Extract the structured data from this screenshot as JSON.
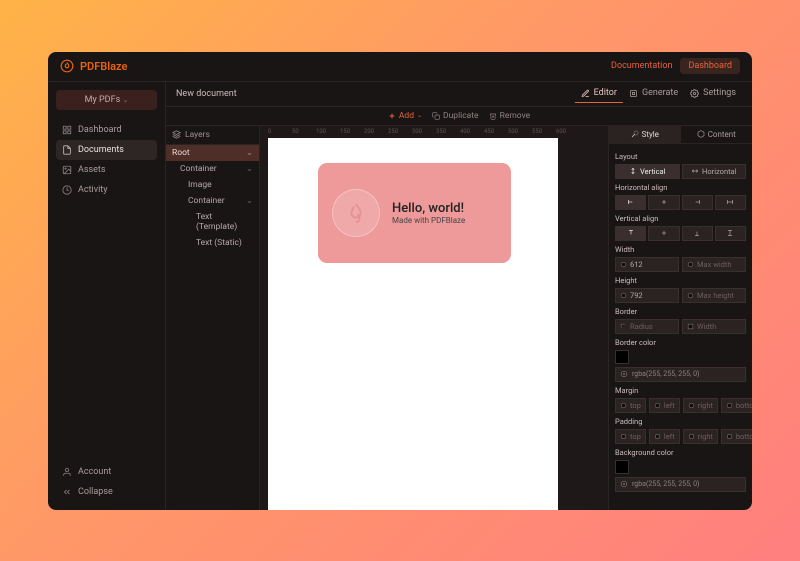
{
  "brand": "PDFBlaze",
  "topbar": {
    "documentation": "Documentation",
    "dashboard": "Dashboard"
  },
  "sidenav": {
    "mypdfs": "My PDFs",
    "items": [
      {
        "label": "Dashboard"
      },
      {
        "label": "Documents"
      },
      {
        "label": "Assets"
      },
      {
        "label": "Activity"
      }
    ],
    "account": "Account",
    "collapse": "Collapse"
  },
  "doc": {
    "title": "New document"
  },
  "tabs": {
    "editor": "Editor",
    "generate": "Generate",
    "settings": "Settings"
  },
  "toolbar": {
    "add": "Add",
    "duplicate": "Duplicate",
    "remove": "Remove"
  },
  "layers": {
    "title": "Layers",
    "nodes": [
      {
        "label": "Root"
      },
      {
        "label": "Container"
      },
      {
        "label": "Image"
      },
      {
        "label": "Container"
      },
      {
        "label": "Text (Template)"
      },
      {
        "label": "Text (Static)"
      }
    ]
  },
  "ruler": {
    "m0": "0",
    "m50": "50",
    "m100": "100",
    "m150": "150",
    "m200": "200",
    "m250": "250",
    "m300": "300",
    "m350": "350",
    "m400": "400",
    "m450": "450",
    "m500": "500",
    "m550": "550",
    "m600": "600"
  },
  "canvas": {
    "hello": "Hello, world!",
    "made": "Made with PDFBlaze"
  },
  "inspector": {
    "tabs": {
      "style": "Style",
      "content": "Content"
    },
    "layout_label": "Layout",
    "layout": {
      "vertical": "Vertical",
      "horizontal": "Horizontal"
    },
    "halign_label": "Horizontal align",
    "valign_label": "Vertical align",
    "width_label": "Width",
    "width_value": "612",
    "maxwidth_ph": "Max width",
    "height_label": "Height",
    "height_value": "792",
    "maxheight_ph": "Max height",
    "border_label": "Border",
    "radius_ph": "Radius",
    "bwidth_ph": "Width",
    "bordercolor_label": "Border color",
    "color_value": "rgba(255, 255, 255, 0)",
    "margin_label": "Margin",
    "sides": {
      "top": "top",
      "left": "left",
      "right": "right",
      "bottom": "bottom"
    },
    "padding_label": "Padding",
    "bgcolor_label": "Background color"
  }
}
